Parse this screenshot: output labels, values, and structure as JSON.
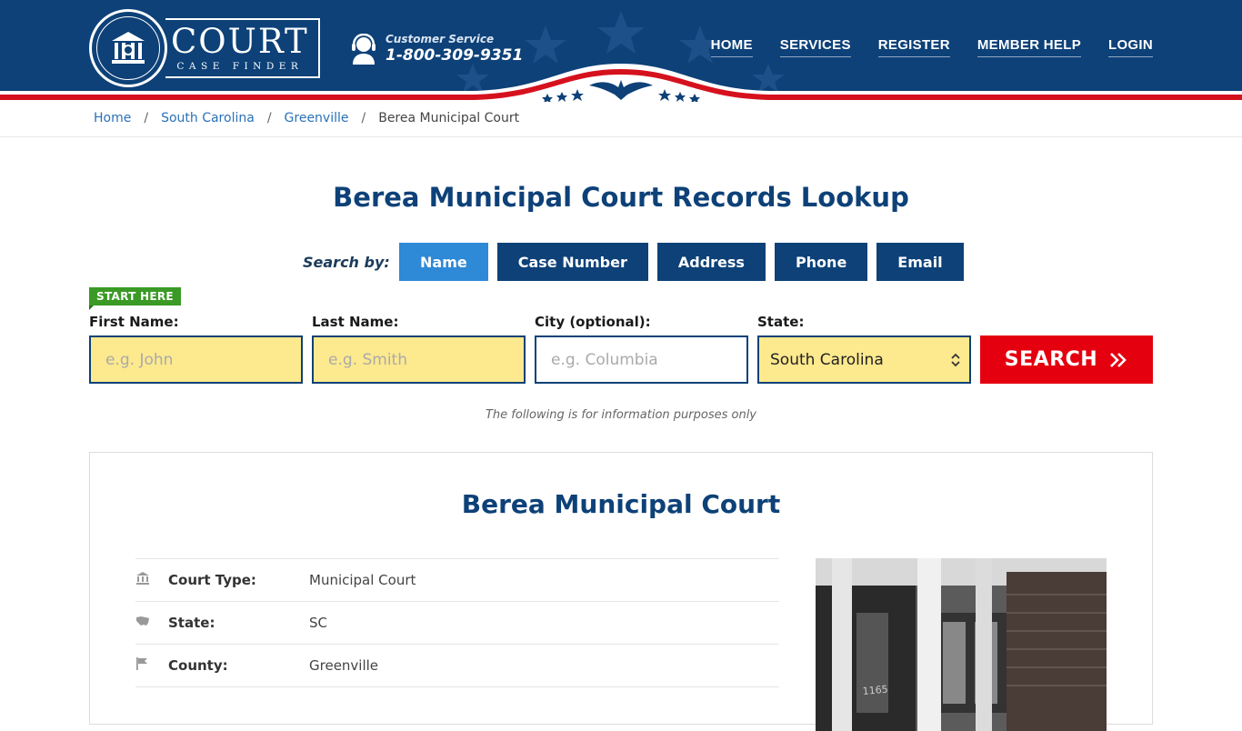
{
  "brand": {
    "name": "COURT",
    "tagline": "CASE FINDER"
  },
  "customer_service": {
    "label": "Customer Service",
    "phone": "1-800-309-9351"
  },
  "nav": {
    "items": [
      {
        "label": "HOME"
      },
      {
        "label": "SERVICES"
      },
      {
        "label": "REGISTER"
      },
      {
        "label": "MEMBER HELP"
      },
      {
        "label": "LOGIN"
      }
    ]
  },
  "breadcrumb": {
    "items": [
      {
        "label": "Home"
      },
      {
        "label": "South Carolina"
      },
      {
        "label": "Greenville"
      }
    ],
    "current": "Berea Municipal Court"
  },
  "page_title": "Berea Municipal Court Records Lookup",
  "search": {
    "search_by_label": "Search by:",
    "tabs": [
      {
        "label": "Name"
      },
      {
        "label": "Case Number"
      },
      {
        "label": "Address"
      },
      {
        "label": "Phone"
      },
      {
        "label": "Email"
      }
    ],
    "start_here": "START HERE",
    "first_name": {
      "label": "First Name:",
      "placeholder": "e.g. John"
    },
    "last_name": {
      "label": "Last Name:",
      "placeholder": "e.g. Smith"
    },
    "city": {
      "label": "City (optional):",
      "placeholder": "e.g.  Columbia"
    },
    "state": {
      "label": "State:",
      "value": "South Carolina"
    },
    "button": "SEARCH"
  },
  "info_note": "The following is for information purposes only",
  "court": {
    "title": "Berea Municipal Court",
    "details": [
      {
        "label": "Court Type:",
        "value": "Municipal Court"
      },
      {
        "label": "State:",
        "value": "SC"
      },
      {
        "label": "County:",
        "value": "Greenville"
      }
    ],
    "photo_sign": "1165"
  },
  "colors": {
    "navy": "#0d4178",
    "accent_blue": "#2e89d6",
    "search_red": "#e4000f",
    "input_yellow": "#fde98e",
    "start_green": "#3a9a25"
  }
}
